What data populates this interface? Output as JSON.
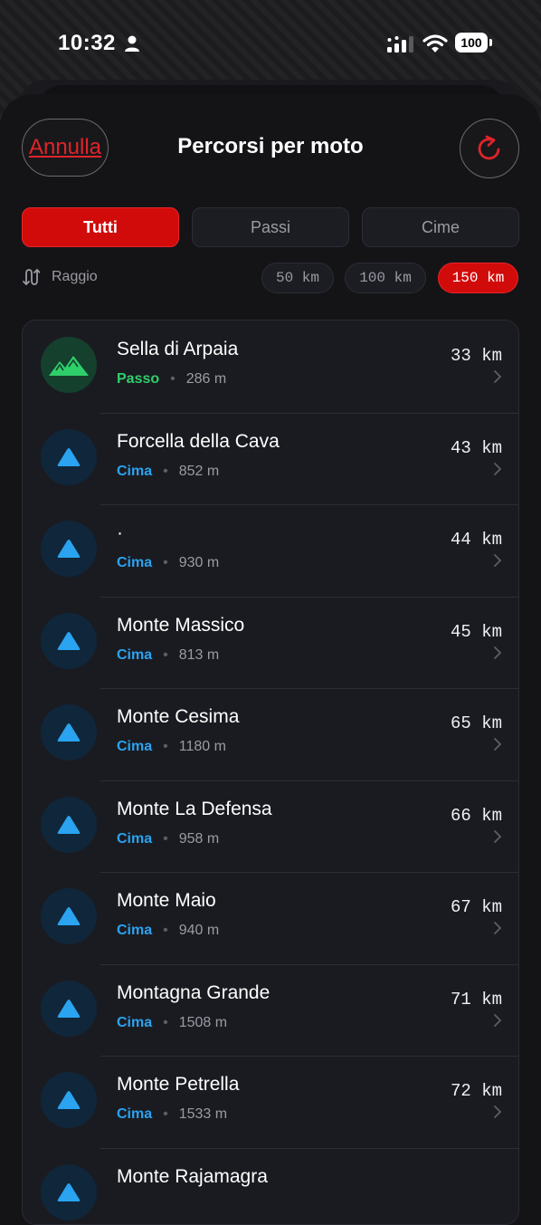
{
  "status_bar": {
    "time": "10:32",
    "battery": "100"
  },
  "header": {
    "cancel_label": "Annulla",
    "title": "Percorsi per moto"
  },
  "tabs": [
    {
      "label": "Tutti",
      "active": true
    },
    {
      "label": "Passi",
      "active": false
    },
    {
      "label": "Cime",
      "active": false
    }
  ],
  "radius": {
    "label": "Raggio",
    "options": [
      {
        "label": "50 km",
        "active": false
      },
      {
        "label": "100 km",
        "active": false
      },
      {
        "label": "150 km",
        "active": true
      }
    ]
  },
  "routes": [
    {
      "name": "Sella di Arpaia",
      "type": "Passo",
      "kind": "pass",
      "elevation": "286 m",
      "distance": "33 km"
    },
    {
      "name": "Forcella della Cava",
      "type": "Cima",
      "kind": "peak",
      "elevation": "852 m",
      "distance": "43 km"
    },
    {
      "name": "·",
      "type": "Cima",
      "kind": "peak",
      "elevation": "930 m",
      "distance": "44 km"
    },
    {
      "name": "Monte Massico",
      "type": "Cima",
      "kind": "peak",
      "elevation": "813 m",
      "distance": "45 km"
    },
    {
      "name": "Monte Cesima",
      "type": "Cima",
      "kind": "peak",
      "elevation": "1180 m",
      "distance": "65 km"
    },
    {
      "name": "Monte La Defensa",
      "type": "Cima",
      "kind": "peak",
      "elevation": "958 m",
      "distance": "66 km"
    },
    {
      "name": "Monte Maio",
      "type": "Cima",
      "kind": "peak",
      "elevation": "940 m",
      "distance": "67 km"
    },
    {
      "name": "Montagna Grande",
      "type": "Cima",
      "kind": "peak",
      "elevation": "1508 m",
      "distance": "71 km"
    },
    {
      "name": "Monte Petrella",
      "type": "Cima",
      "kind": "peak",
      "elevation": "1533 m",
      "distance": "72 km"
    },
    {
      "name": "Monte Rajamagra",
      "type": "",
      "kind": "peak",
      "elevation": "",
      "distance": ""
    }
  ],
  "colors": {
    "accent_red": "#d10a0a",
    "pass_green": "#2ecf6a",
    "peak_blue": "#2aa3f0"
  },
  "icons": {
    "pass": "mountains-icon",
    "peak": "triangle-icon",
    "refresh": "refresh-icon",
    "radius": "route-icon"
  }
}
